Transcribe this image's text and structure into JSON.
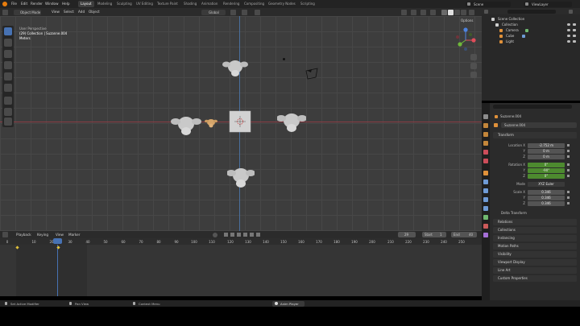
{
  "topbar": {
    "menus": [
      "File",
      "Edit",
      "Render",
      "Window",
      "Help"
    ],
    "workspaces": [
      "Layout",
      "Modeling",
      "Sculpting",
      "UV Editing",
      "Texture Paint",
      "Shading",
      "Animation",
      "Rendering",
      "Compositing",
      "Geometry Nodes",
      "Scripting"
    ],
    "active_workspace": "Layout",
    "scene_label": "Scene",
    "view_layer_label": "ViewLayer"
  },
  "viewport_header": {
    "mode": "Object Mode",
    "menus": [
      "View",
      "Select",
      "Add",
      "Object"
    ],
    "transform": "Global",
    "options": "Options"
  },
  "viewport": {
    "view_name": "User Perspective",
    "collection_path": "(29) Collection | Suzanne.004",
    "units": "Meters"
  },
  "outliner": {
    "title": "Scene Collection",
    "rows": [
      {
        "label": "Collection",
        "icon": "collection-icon"
      },
      {
        "label": "Camera",
        "icon": "camera-icon"
      },
      {
        "label": "Cube",
        "icon": "mesh-icon"
      },
      {
        "label": "Light",
        "icon": "light-icon"
      }
    ]
  },
  "properties": {
    "object_name": "Suzanne.004",
    "object_field": "Suzanne.004",
    "transform_header": "Transform",
    "location_label": "Location X",
    "location": [
      "-2.752 m",
      "0 m",
      "0 m"
    ],
    "rotation_label": "Rotation X",
    "rotation": [
      "0°",
      "-90°",
      "0°"
    ],
    "mode_label": "Mode",
    "mode_value": "XYZ Euler",
    "scale_label": "Scale X",
    "scale": [
      "0.346",
      "0.346",
      "0.346"
    ],
    "axis_labels": [
      "Y",
      "Z"
    ],
    "delta_transform": "Delta Transform",
    "panels": [
      "Relations",
      "Collections",
      "Instancing",
      "Motion Paths",
      "Visibility",
      "Viewport Display",
      "Line Art",
      "Custom Properties"
    ]
  },
  "timeline": {
    "menus": [
      "Playback",
      "Keying",
      "View",
      "Marker"
    ],
    "current_frame": "29",
    "start_label": "Start",
    "start": "1",
    "end_label": "End",
    "end": "40",
    "ticks": [
      "0",
      "10",
      "20",
      "30",
      "40",
      "50",
      "60",
      "70",
      "80",
      "90",
      "100",
      "110",
      "120",
      "130",
      "140",
      "150",
      "160",
      "170",
      "180",
      "190",
      "200",
      "210",
      "220",
      "230",
      "240",
      "250"
    ]
  },
  "statusbar": {
    "items": [
      "Set Active Modifier",
      "Pan View",
      "Context Menu",
      "Anim Player"
    ]
  }
}
